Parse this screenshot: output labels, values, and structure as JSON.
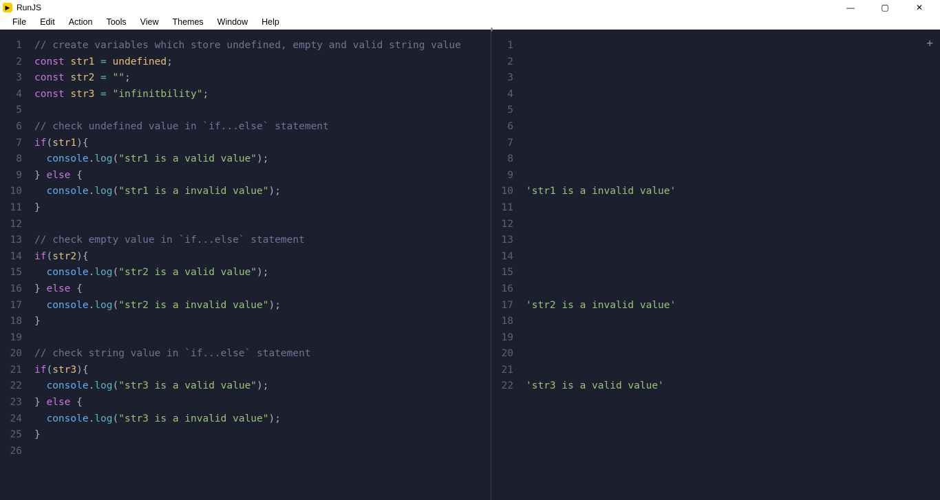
{
  "app": {
    "title": "RunJS"
  },
  "menu": [
    "File",
    "Edit",
    "Action",
    "Tools",
    "View",
    "Themes",
    "Window",
    "Help"
  ],
  "code": {
    "lines": [
      {
        "t": "cm",
        "s": "// create variables which store undefined, empty and valid string value"
      },
      {
        "t": "decl",
        "kw": "const",
        "name": "str1",
        "eq": "=",
        "val": "undefined",
        "valType": "un",
        "end": ";"
      },
      {
        "t": "decl",
        "kw": "const",
        "name": "str2",
        "eq": "=",
        "val": "\"\"",
        "valType": "st",
        "end": ";"
      },
      {
        "t": "decl",
        "kw": "const",
        "name": "str3",
        "eq": "=",
        "val": "\"infinitbility\"",
        "valType": "st",
        "end": ";"
      },
      {
        "t": "blank"
      },
      {
        "t": "cm",
        "s": "// check undefined value in `if...else` statement"
      },
      {
        "t": "if",
        "kw": "if",
        "p1": "(",
        "v": "str1",
        "p2": "){"
      },
      {
        "t": "log",
        "indent": "  ",
        "obj": "console",
        "dot": ".",
        "fn": "log",
        "p1": "(",
        "str": "\"str1 is a valid value\"",
        "p2": ");"
      },
      {
        "t": "else",
        "s1": "} ",
        "kw": "else",
        "s2": " {"
      },
      {
        "t": "log",
        "indent": "  ",
        "obj": "console",
        "dot": ".",
        "fn": "log",
        "p1": "(",
        "str": "\"str1 is a invalid value\"",
        "p2": ");"
      },
      {
        "t": "close",
        "s": "}"
      },
      {
        "t": "blank"
      },
      {
        "t": "cm",
        "s": "// check empty value in `if...else` statement"
      },
      {
        "t": "if",
        "kw": "if",
        "p1": "(",
        "v": "str2",
        "p2": "){"
      },
      {
        "t": "log",
        "indent": "  ",
        "obj": "console",
        "dot": ".",
        "fn": "log",
        "p1": "(",
        "str": "\"str2 is a valid value\"",
        "p2": ");"
      },
      {
        "t": "else",
        "s1": "} ",
        "kw": "else",
        "s2": " {"
      },
      {
        "t": "log",
        "indent": "  ",
        "obj": "console",
        "dot": ".",
        "fn": "log",
        "p1": "(",
        "str": "\"str2 is a invalid value\"",
        "p2": ");"
      },
      {
        "t": "close",
        "s": "}"
      },
      {
        "t": "blank"
      },
      {
        "t": "cm",
        "s": "// check string value in `if...else` statement"
      },
      {
        "t": "if",
        "kw": "if",
        "p1": "(",
        "v": "str3",
        "p2": "){"
      },
      {
        "t": "log",
        "indent": "  ",
        "obj": "console",
        "dot": ".",
        "fn": "log",
        "p1": "(",
        "str": "\"str3 is a valid value\"",
        "p2": ");"
      },
      {
        "t": "else",
        "s1": "} ",
        "kw": "else",
        "s2": " {"
      },
      {
        "t": "log",
        "indent": "  ",
        "obj": "console",
        "dot": ".",
        "fn": "log",
        "p1": "(",
        "str": "\"str3 is a invalid value\"",
        "p2": ");"
      },
      {
        "t": "close",
        "s": "}"
      },
      {
        "t": "blank"
      }
    ]
  },
  "output": {
    "10": "'str1 is a invalid value'",
    "17": "'str2 is a invalid value'",
    "22": "'str3 is a valid value'"
  },
  "outputLines": 22
}
